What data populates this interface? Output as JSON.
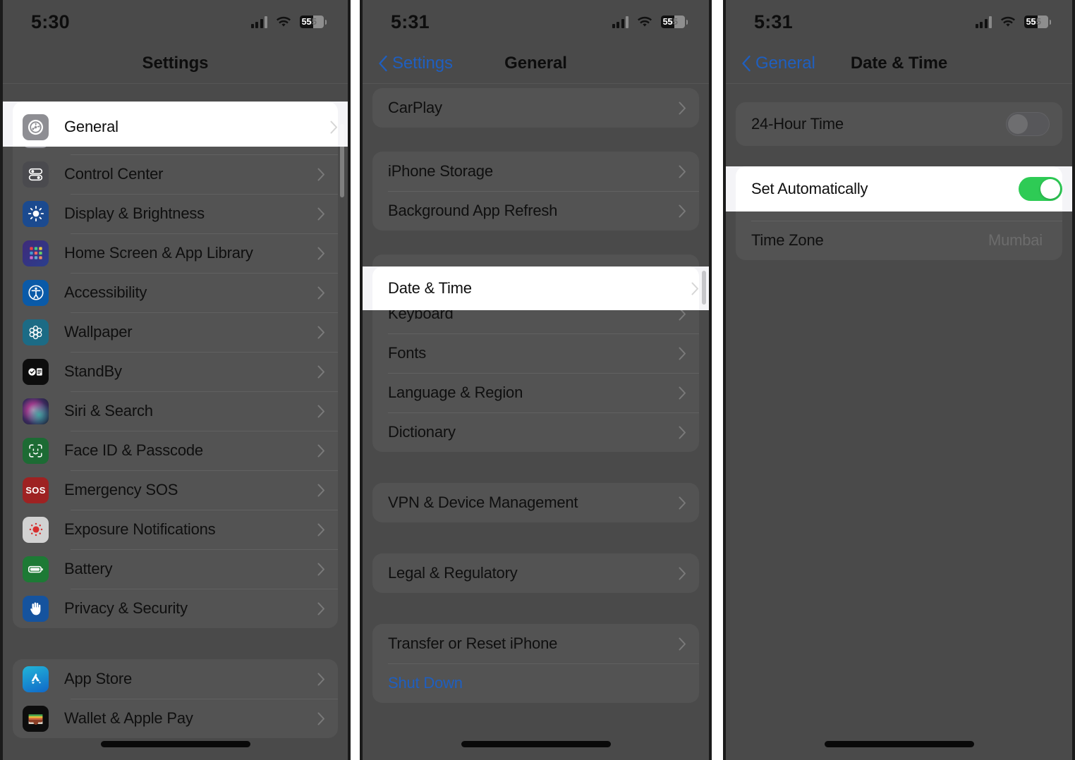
{
  "panels": [
    {
      "id": "settings",
      "status": {
        "time": "5:30",
        "battery_percent": "55",
        "wifi": "wifi-icon",
        "signal": "cellular-signal-icon"
      },
      "nav": {
        "title": "Settings",
        "back_label": ""
      },
      "sections": [
        {
          "rows": [
            {
              "label": "General",
              "icon": "gear-icon",
              "icon_color": "#8e8e93",
              "highlighted": true
            },
            {
              "label": "Control Center",
              "icon": "control-center-icon",
              "icon_color": "#4a4a4e"
            },
            {
              "label": "Display & Brightness",
              "icon": "brightness-icon",
              "icon_color": "#1b4a8f"
            },
            {
              "label": "Home Screen & App Library",
              "icon": "app-grid-icon",
              "icon_color": "#3a2a6e"
            },
            {
              "label": "Accessibility",
              "icon": "accessibility-icon",
              "icon_color": "#0a5aa8"
            },
            {
              "label": "Wallpaper",
              "icon": "wallpaper-icon",
              "icon_color": "#1c6b85"
            },
            {
              "label": "StandBy",
              "icon": "standby-icon",
              "icon_color": "#0d0d0d"
            },
            {
              "label": "Siri & Search",
              "icon": "siri-icon",
              "icon_color": "#2b1a33"
            },
            {
              "label": "Face ID & Passcode",
              "icon": "face-id-icon",
              "icon_color": "#1d6b34"
            },
            {
              "label": "Emergency SOS",
              "icon": "sos-icon",
              "icon_color": "#9e2222"
            },
            {
              "label": "Exposure Notifications",
              "icon": "exposure-icon",
              "icon_color": "#d8d8d8"
            },
            {
              "label": "Battery",
              "icon": "battery-icon",
              "icon_color": "#1d7a35"
            },
            {
              "label": "Privacy & Security",
              "icon": "hand-icon",
              "icon_color": "#15539e"
            }
          ]
        },
        {
          "rows": [
            {
              "label": "App Store",
              "icon": "app-store-icon",
              "icon_color": "#1878c8"
            },
            {
              "label": "Wallet & Apple Pay",
              "icon": "wallet-icon",
              "icon_color": "#0d0d0d"
            }
          ]
        }
      ]
    },
    {
      "id": "general",
      "status": {
        "time": "5:31",
        "battery_percent": "55",
        "wifi": "wifi-icon",
        "signal": "cellular-signal-icon"
      },
      "nav": {
        "title": "General",
        "back_label": "Settings"
      },
      "sections": [
        {
          "rows": [
            {
              "label": "CarPlay"
            }
          ]
        },
        {
          "rows": [
            {
              "label": "iPhone Storage"
            },
            {
              "label": "Background App Refresh"
            }
          ]
        },
        {
          "rows": [
            {
              "label": "Date & Time",
              "highlighted": true
            },
            {
              "label": "Keyboard"
            },
            {
              "label": "Fonts"
            },
            {
              "label": "Language & Region"
            },
            {
              "label": "Dictionary"
            }
          ]
        },
        {
          "rows": [
            {
              "label": "VPN & Device Management"
            }
          ]
        },
        {
          "rows": [
            {
              "label": "Legal & Regulatory"
            }
          ]
        },
        {
          "rows": [
            {
              "label": "Transfer or Reset iPhone"
            },
            {
              "label": "Shut Down",
              "style": "blue",
              "no_chevron": true
            }
          ]
        }
      ]
    },
    {
      "id": "date-time",
      "status": {
        "time": "5:31",
        "battery_percent": "55",
        "wifi": "wifi-icon",
        "signal": "cellular-signal-icon"
      },
      "nav": {
        "title": "Date & Time",
        "back_label": "General"
      },
      "sections": [
        {
          "rows": [
            {
              "label": "24-Hour Time",
              "toggle": "off"
            }
          ]
        },
        {
          "rows": [
            {
              "label": "Set Automatically",
              "toggle": "on",
              "highlighted": true
            },
            {
              "label": "Time Zone",
              "value": "Mumbai",
              "no_chevron": true
            }
          ]
        }
      ]
    }
  ],
  "colors": {
    "accent_blue": "#1f5fbf",
    "toggle_on_green": "#2ecb55",
    "dim_overlay": "#4a4a4a",
    "highlight_white": "#ffffff"
  }
}
